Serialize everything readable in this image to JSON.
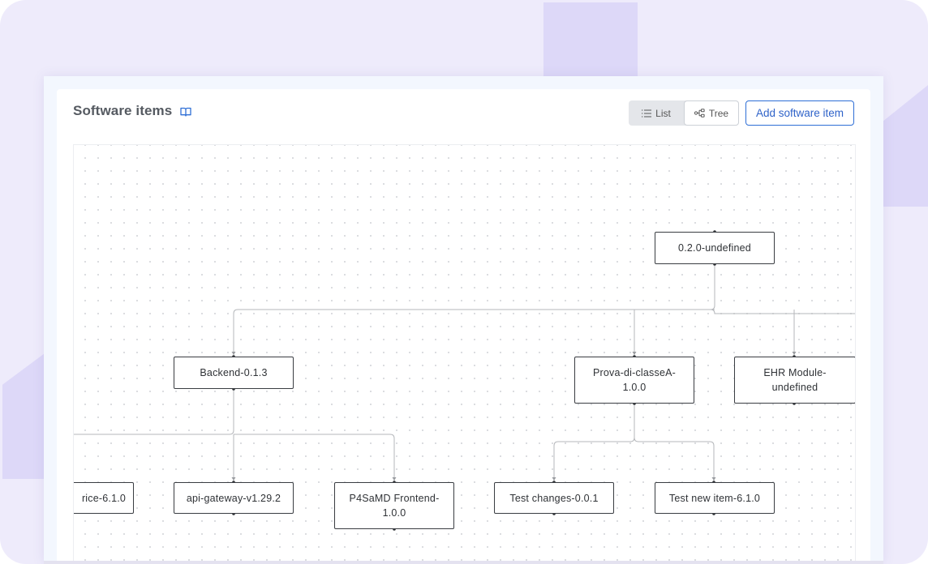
{
  "page": {
    "title": "Software items"
  },
  "toolbar": {
    "list_label": "List",
    "tree_label": "Tree",
    "add_label": "Add software item",
    "active_view": "Tree"
  },
  "colors": {
    "accent": "#2f6fd6",
    "background": "#eeebfb",
    "node_border": "#3a3d42",
    "connector": "#b5b7bb"
  },
  "icons": {
    "docs": "book-open-icon",
    "list": "list-icon",
    "tree": "tree-icon"
  },
  "tree": {
    "root": {
      "label": "0.2.0-undefined"
    },
    "level1": [
      {
        "label": "Backend-0.1.3"
      },
      {
        "label": "Prova-di-classeA-\n1.0.0"
      },
      {
        "label": "EHR Module-\nundefined"
      }
    ],
    "level2": [
      {
        "label": "rice-6.1.0"
      },
      {
        "label": "api-gateway-v1.29.2"
      },
      {
        "label": "P4SaMD Frontend-\n1.0.0"
      },
      {
        "label": "Test changes-0.0.1"
      },
      {
        "label": "Test new item-6.1.0"
      }
    ]
  }
}
